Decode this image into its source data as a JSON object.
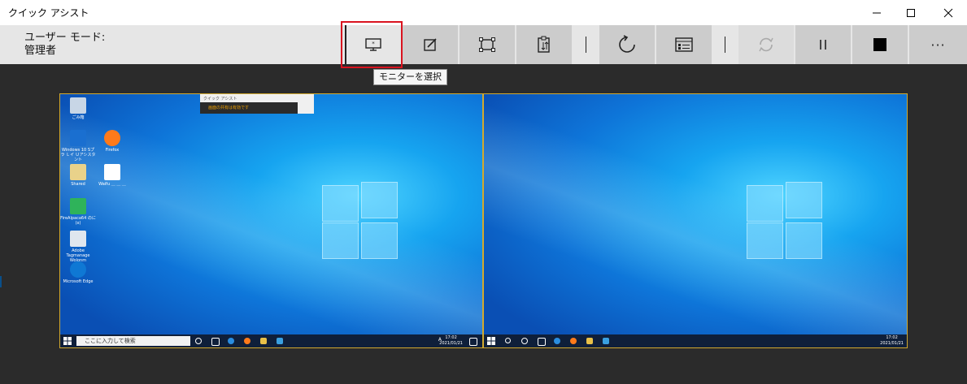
{
  "window": {
    "title": "クイック アシスト"
  },
  "toolbar": {
    "mode_line1": "ユーザー モード:",
    "mode_line2": "管理者",
    "buttons": [
      {
        "name": "select-monitor",
        "icon": "monitor-icon"
      },
      {
        "name": "annotate",
        "icon": "pencil-icon"
      },
      {
        "name": "actual-size",
        "icon": "fit-frame-icon"
      },
      {
        "name": "toggle-instruction-channel",
        "icon": "clipboard-icon"
      },
      {
        "name": "restart",
        "icon": "restart-icon"
      },
      {
        "name": "task-manager",
        "icon": "task-manager-icon"
      },
      {
        "name": "reconnect",
        "icon": "reconnect-icon",
        "disabled": true
      },
      {
        "name": "pause",
        "icon": "pause-icon"
      },
      {
        "name": "end",
        "icon": "stop-icon"
      },
      {
        "name": "more",
        "icon": "more-icon"
      }
    ],
    "more_label": "···",
    "pause_label": "||"
  },
  "tooltip": {
    "text": "モニターを選択"
  },
  "remote": {
    "left_monitor": {
      "search_placeholder": "ここに入力して検索",
      "clock_time": "17:02",
      "clock_date": "2021/01/21",
      "ime": "A",
      "mini_window_title": "クイック アシスト",
      "mini_window_status": "画面の共有は有効です",
      "desktop_icons": [
        "ごみ箱",
        "Windows 10 Sプラ Ｌイ Ｕアシスタント",
        "Firefox",
        "Shared",
        "Waifu ＿ ＿ ＿",
        "FireAlpaca64 のに(x)",
        "Adobe Tagmanage Wolonm",
        "Microsoft Edge"
      ]
    },
    "right_monitor": {
      "clock_time": "17:02",
      "clock_date": "2021/01/21"
    }
  },
  "colors": {
    "highlight": "#d9131f",
    "monitor_border": "#d2a92e",
    "background": "#2b2b2b"
  }
}
